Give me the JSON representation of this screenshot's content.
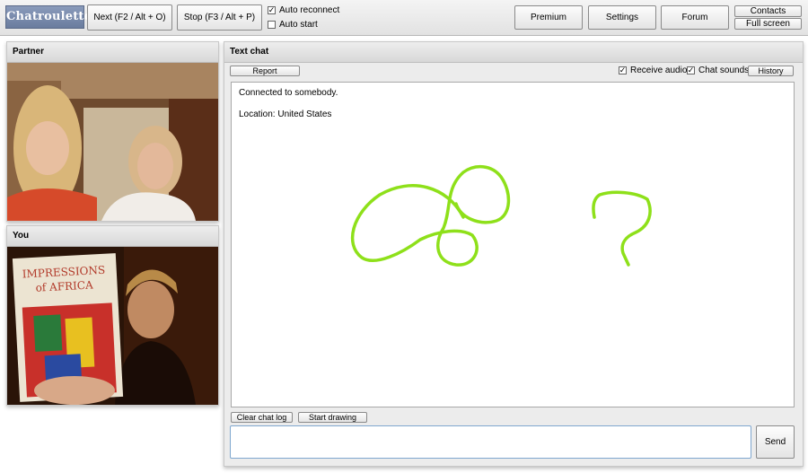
{
  "app": {
    "logo": "Chatroulette"
  },
  "toolbar": {
    "next_label": "Next (F2 / Alt + O)",
    "stop_label": "Stop (F3 / Alt + P)",
    "auto_reconnect": {
      "label": "Auto reconnect",
      "checked": true
    },
    "auto_start": {
      "label": "Auto start",
      "checked": false
    },
    "premium_label": "Premium",
    "settings_label": "Settings",
    "forum_label": "Forum",
    "contacts_label": "Contacts",
    "fullscreen_label": "Full screen"
  },
  "partner_panel": {
    "title": "Partner"
  },
  "you_panel": {
    "title": "You",
    "book_title_line1": "IMPRESSIONS",
    "book_title_line2": "of AFRICA"
  },
  "chat": {
    "title": "Text chat",
    "report_label": "Report",
    "receive_audio": {
      "label": "Receive audio",
      "checked": true
    },
    "chat_sounds": {
      "label": "Chat sounds",
      "checked": true
    },
    "history_label": "History",
    "messages": [
      "Connected to somebody.",
      "Location: United States"
    ],
    "clear_log_label": "Clear chat log",
    "start_drawing_label": "Start drawing",
    "input_value": "",
    "send_label": "Send"
  },
  "colors": {
    "drawing_stroke": "#8ee01a",
    "logo_bg": "#7a8bad",
    "input_border": "#7fa7cf"
  },
  "icons": {
    "checked": "checkmark-icon"
  }
}
